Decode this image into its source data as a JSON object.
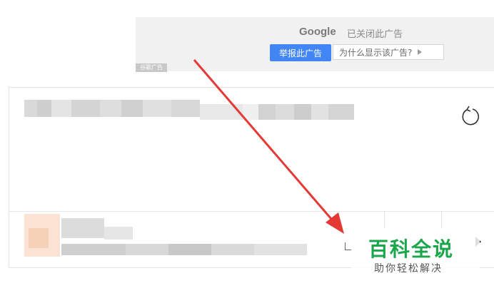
{
  "ad_feedback": {
    "brand": "Google",
    "closed_text": "已关闭此广告",
    "report_button": "举报此广告",
    "why_button": "为什么显示该广告?",
    "ad_tag": "谷歌广告"
  },
  "watermark": {
    "title": "百科全说",
    "subtitle": "助你轻松解决"
  },
  "colors": {
    "report_button_bg": "#4285f4",
    "annotation_arrow": "#e53935",
    "watermark_green": "#1aa64a"
  },
  "icons": {
    "refresh": "refresh-icon",
    "play": "play-icon",
    "next": "chevron-right-icon"
  }
}
